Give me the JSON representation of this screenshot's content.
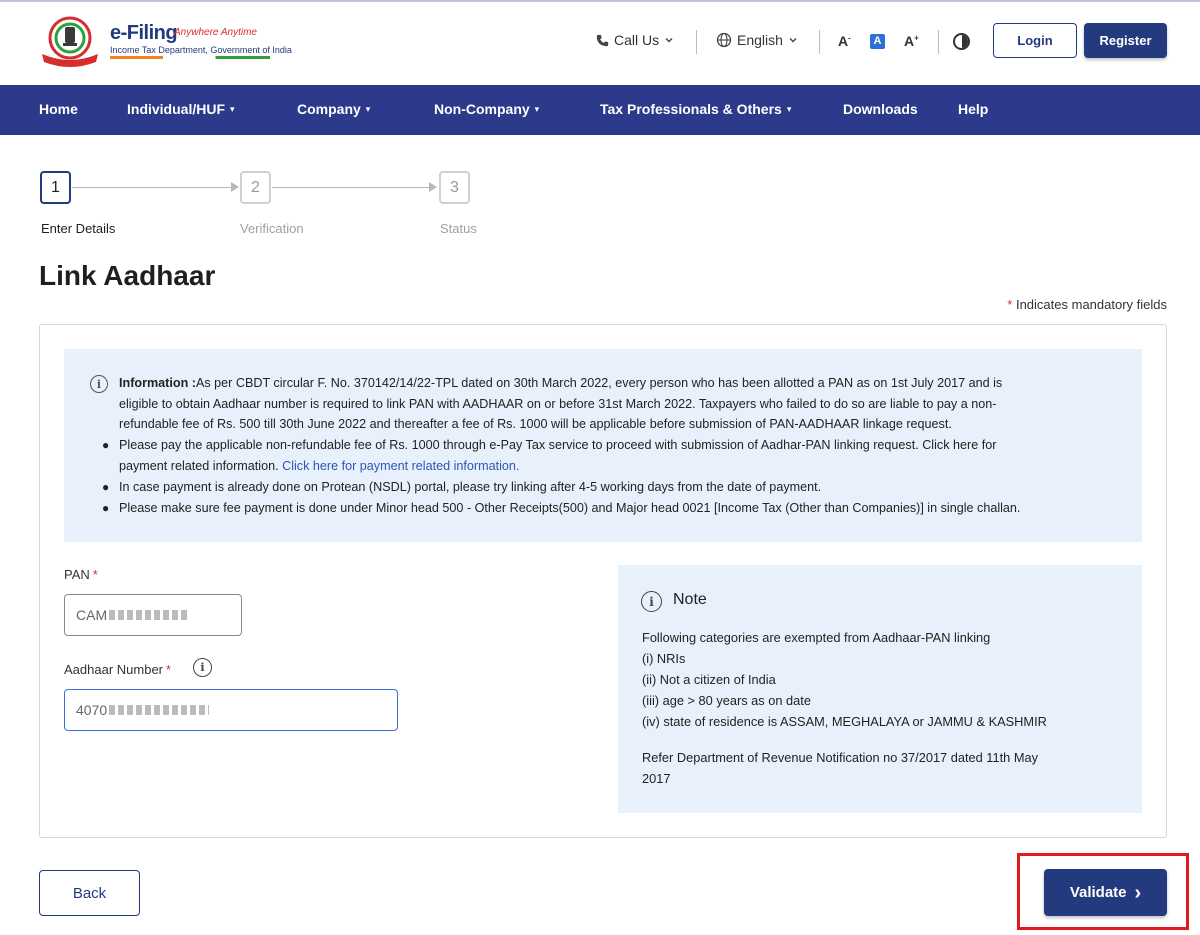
{
  "header": {
    "logo_title": "e-Filing",
    "logo_tagline": "Anywhere Anytime",
    "logo_subtitle": "Income Tax Department, Government of India",
    "call_us": "Call Us",
    "language": "English",
    "font_decrease": "A",
    "font_default": "A",
    "font_increase": "A",
    "login": "Login",
    "register": "Register"
  },
  "nav": {
    "items": [
      {
        "label": "Home",
        "has_dropdown": false
      },
      {
        "label": "Individual/HUF",
        "has_dropdown": true
      },
      {
        "label": "Company",
        "has_dropdown": true
      },
      {
        "label": "Non-Company",
        "has_dropdown": true
      },
      {
        "label": "Tax Professionals & Others",
        "has_dropdown": true
      },
      {
        "label": "Downloads",
        "has_dropdown": false
      },
      {
        "label": "Help",
        "has_dropdown": false
      }
    ],
    "caret": "▾"
  },
  "stepper": {
    "steps": [
      {
        "number": "1",
        "label": "Enter Details",
        "active": true
      },
      {
        "number": "2",
        "label": "Verification",
        "active": false
      },
      {
        "number": "3",
        "label": "Status",
        "active": false
      }
    ]
  },
  "page": {
    "title": "Link Aadhaar",
    "mandatory_star": "*",
    "mandatory_note": "Indicates mandatory fields"
  },
  "info": {
    "heading": "Information :",
    "paragraph_line1": "As per CBDT circular F. No. 370142/14/22-TPL dated on 30th March 2022, every person who has been allotted a PAN as on 1st July 2017 and is",
    "paragraph_line2": "eligible to obtain Aadhaar number is required to link PAN with AADHAAR on or before 31st March 2022. Taxpayers who failed to do so are liable to pay a non-",
    "paragraph_line3": "refundable fee of Rs. 500 till 30th June 2022 and thereafter a fee of Rs. 1000 will be applicable before submission of PAN-AADHAAR linkage request.",
    "bullet1_line1": "Please pay the applicable non-refundable fee of Rs. 1000 through e-Pay Tax service to proceed with submission of Aadhar-PAN linking request. Click here for",
    "bullet1_line2_prefix": "payment related information.",
    "bullet1_link": "Click here for payment related information.",
    "bullet2": "In case payment is already done on Protean (NSDL) portal, please try linking after 4-5 working days from the date of payment.",
    "bullet3": "Please make sure fee payment is done under Minor head 500 - Other Receipts(500) and Major head 0021 [Income Tax (Other than Companies)] in single challan."
  },
  "form": {
    "pan_label": "PAN",
    "pan_star": "*",
    "pan_value_visible": "CAM",
    "aadhaar_label": "Aadhaar Number",
    "aadhaar_star": "*",
    "aadhaar_value_visible": "4070",
    "help_icon": "i"
  },
  "note": {
    "title": "Note",
    "intro": "Following categories are exempted from Aadhaar-PAN linking",
    "items": [
      "(i) NRIs",
      "(ii) Not a citizen of India",
      "(iii) age > 80 years as on date",
      "(iv) state of residence is ASSAM, MEGHALAYA or JAMMU & KASHMIR"
    ],
    "refer_line1": "Refer Department of Revenue Notification no 37/2017 dated 11th May",
    "refer_line2": "2017"
  },
  "actions": {
    "back": "Back",
    "validate": "Validate",
    "validate_chevron": "›"
  },
  "colors": {
    "brand_navy": "#233a7e",
    "nav_bg": "#2d3a8c",
    "info_bg": "#e8f1fb",
    "highlight_red": "#e0191f",
    "required_star": "#d62d2d"
  }
}
